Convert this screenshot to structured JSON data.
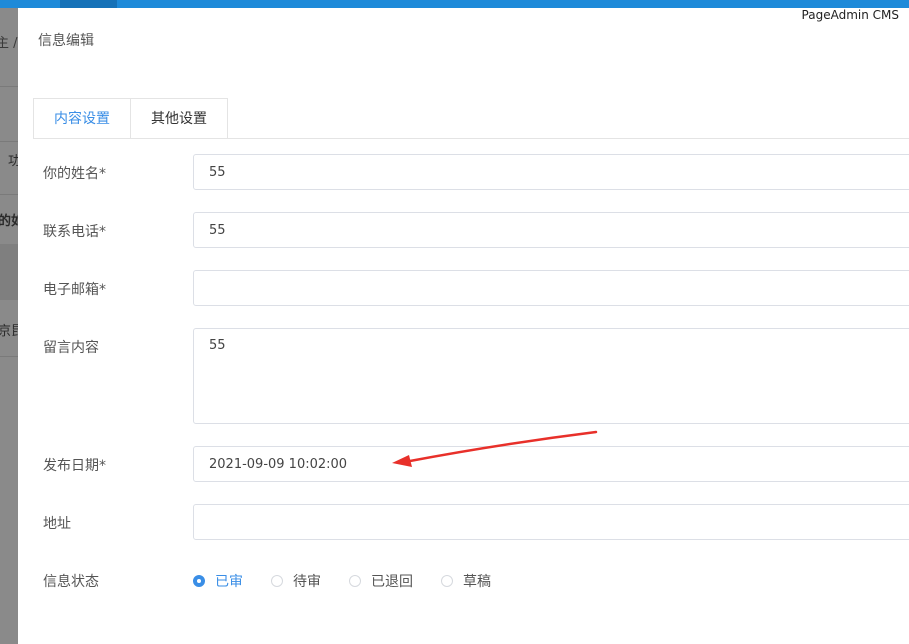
{
  "brand": "PageAdmin CMS",
  "underlay": {
    "breadcrumb": "主 /",
    "fragment1": "功",
    "fragment2": "的如",
    "fragment3": "京昆"
  },
  "dialog": {
    "title": "信息编辑",
    "tabs": [
      {
        "label": "内容设置",
        "active": true
      },
      {
        "label": "其他设置",
        "active": false
      }
    ]
  },
  "form": {
    "name": {
      "label": "你的姓名*",
      "value": "55"
    },
    "phone": {
      "label": "联系电话*",
      "value": "55"
    },
    "email": {
      "label": "电子邮箱*",
      "value": ""
    },
    "message": {
      "label": "留言内容",
      "value": "55"
    },
    "publish_date": {
      "label": "发布日期*",
      "value": "2021-09-09 10:02:00"
    },
    "address": {
      "label": "地址",
      "value": ""
    },
    "status": {
      "label": "信息状态",
      "options": [
        {
          "label": "已审",
          "checked": true
        },
        {
          "label": "待审",
          "checked": false
        },
        {
          "label": "已退回",
          "checked": false
        },
        {
          "label": "草稿",
          "checked": false
        }
      ]
    }
  },
  "annotation": {
    "color": "#e8302a"
  },
  "colors": {
    "accent": "#3a8ee6",
    "top_bar": "#1e8ad9"
  }
}
